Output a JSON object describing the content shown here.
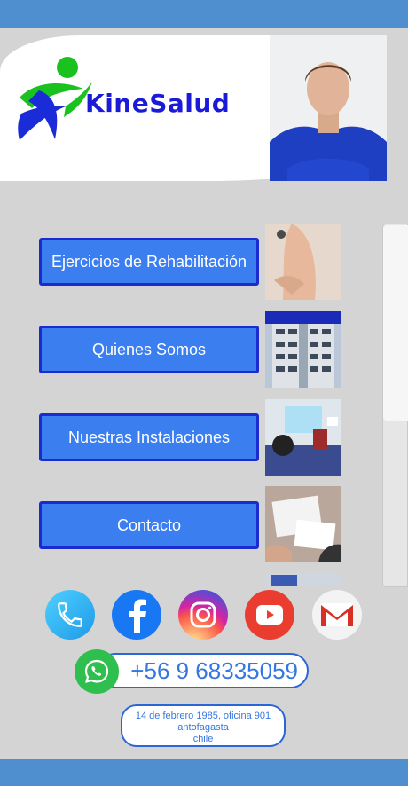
{
  "header": {
    "brand": "KineSalud",
    "logo_icon": "running-figure-logo-icon",
    "photo": "physiotherapist-portrait-photo"
  },
  "menu": [
    {
      "label": "Ejercicios de Rehabilitación",
      "thumb": "back-massage-photo"
    },
    {
      "label": "Quienes Somos",
      "thumb": "building-photo"
    },
    {
      "label": "Nuestras Instalaciones",
      "thumb": "gym-facility-photo"
    },
    {
      "label": "Contacto",
      "thumb": "desk-documents-photo"
    }
  ],
  "social": [
    {
      "name": "phone-icon",
      "color": "#2ab8f0"
    },
    {
      "name": "facebook-icon",
      "color": "#1877f2"
    },
    {
      "name": "instagram-icon",
      "color": "#d6249f"
    },
    {
      "name": "youtube-icon",
      "color": "#e62117"
    },
    {
      "name": "gmail-icon",
      "color": "#ffffff"
    }
  ],
  "contact": {
    "phone": "+56 9 68335059",
    "whatsapp_icon": "whatsapp-icon"
  },
  "address": {
    "line1": "14 de febrero 1985, oficina 901",
    "line2": "antofagasta",
    "line3": "chile"
  },
  "colors": {
    "bar": "#4f8fcf",
    "button": "#3b7ef0",
    "button_border": "#1a2bd0",
    "brand": "#1a1ad8"
  }
}
